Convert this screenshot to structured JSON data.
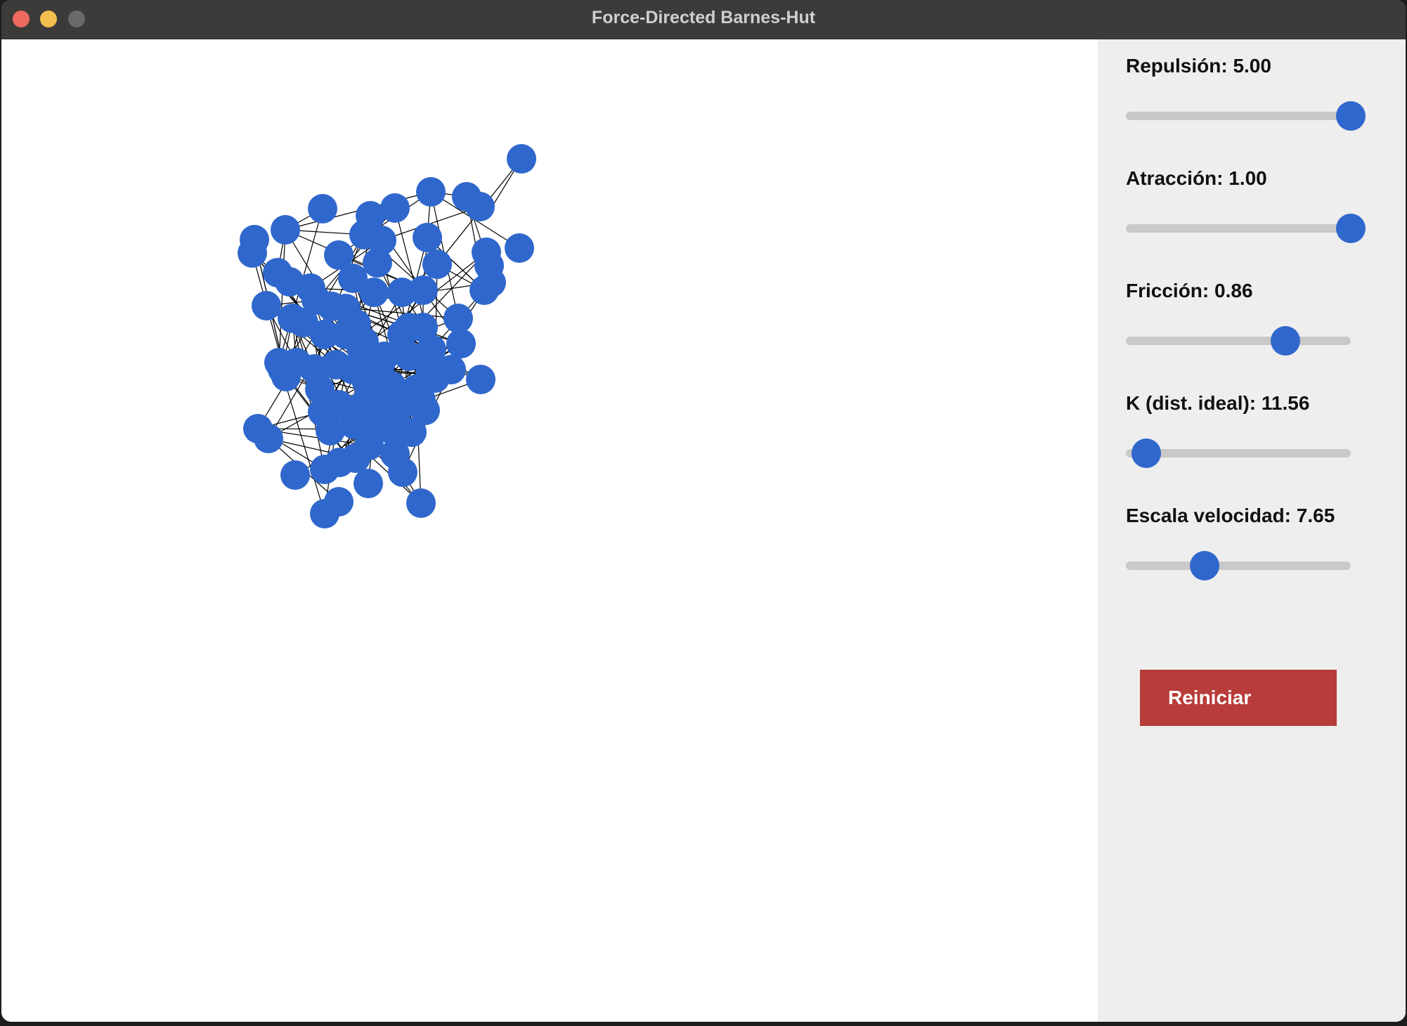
{
  "window": {
    "title": "Force-Directed Barnes-Hut"
  },
  "sliders": [
    {
      "label": "Repulsión: 5.00",
      "fraction": 1.0
    },
    {
      "label": "Atracción: 1.00",
      "fraction": 1.0
    },
    {
      "label": "Fricción: 0.86",
      "fraction": 0.71
    },
    {
      "label": "K (dist. ideal): 11.56",
      "fraction": 0.09
    },
    {
      "label": "Escala velocidad: 7.65",
      "fraction": 0.35
    }
  ],
  "reset_button": {
    "label": "Reiniciar"
  },
  "colors": {
    "node": "#2f67cc",
    "edge": "#000000",
    "reset_button": "#b73c3a",
    "sidebar": "#eeeeee",
    "titlebar": "#3d3a3a"
  },
  "graph": {
    "node_count": 90
  }
}
